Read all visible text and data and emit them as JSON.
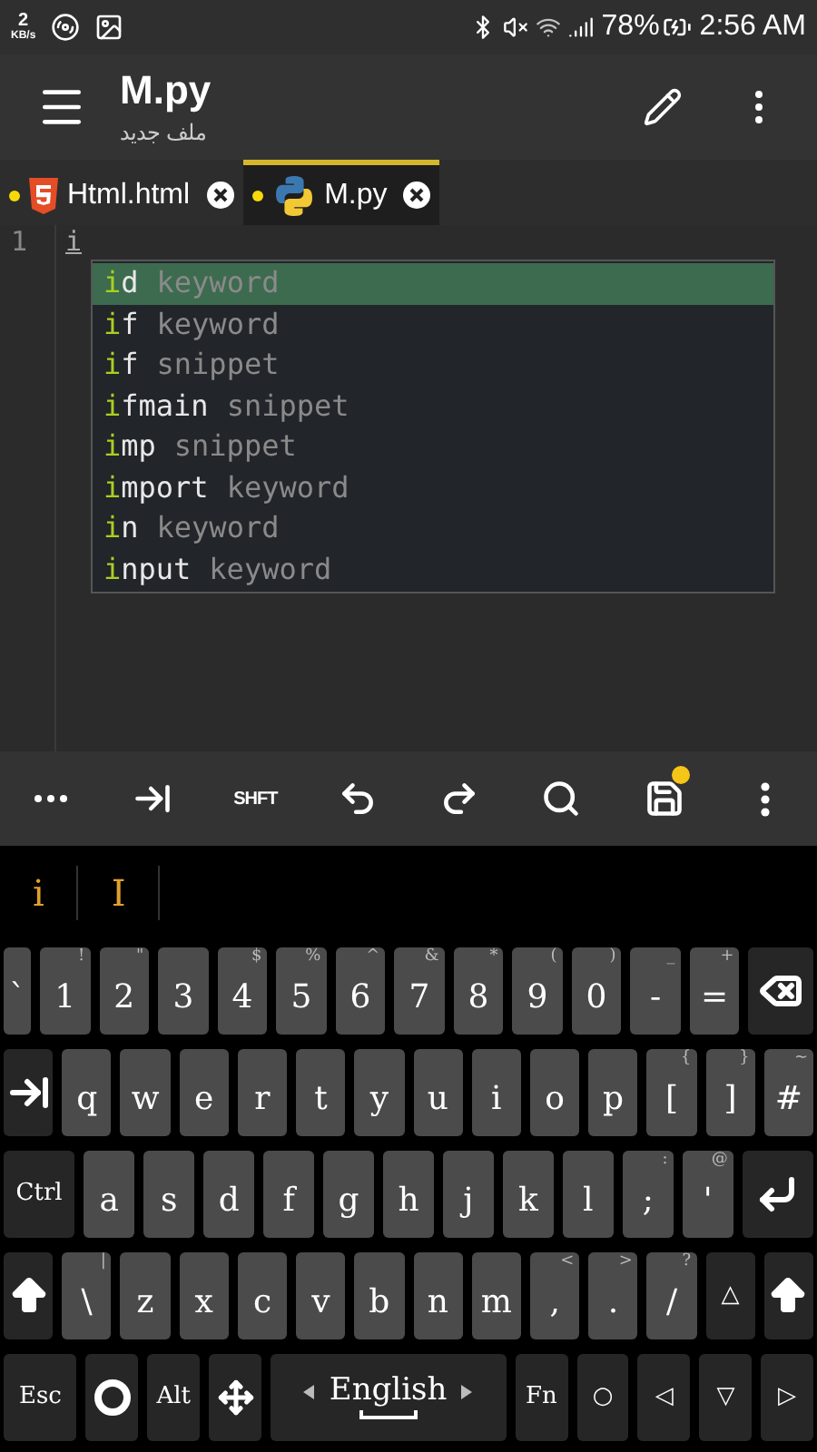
{
  "status_bar": {
    "speed_value": "2",
    "speed_unit": "KB/s",
    "battery": "78%",
    "time": "2:56 AM"
  },
  "app_bar": {
    "title": "M.py",
    "subtitle": "ملف جديد"
  },
  "tabs": [
    {
      "label": "Html.html",
      "kind": "html",
      "modified": true,
      "selected": false
    },
    {
      "label": "M.py",
      "kind": "python",
      "modified": true,
      "selected": true
    }
  ],
  "editor": {
    "line_numbers": [
      "1"
    ],
    "lines": [
      "i"
    ]
  },
  "autocomplete": [
    {
      "match": "i",
      "rest": "d",
      "type": "keyword",
      "selected": true
    },
    {
      "match": "i",
      "rest": "f",
      "type": "keyword",
      "selected": false
    },
    {
      "match": "i",
      "rest": "f",
      "type": "snippet",
      "selected": false
    },
    {
      "match": "i",
      "rest": "fmain",
      "type": "snippet",
      "selected": false
    },
    {
      "match": "i",
      "rest": "mp",
      "type": "snippet",
      "selected": false
    },
    {
      "match": "i",
      "rest": "mport",
      "type": "keyword",
      "selected": false
    },
    {
      "match": "i",
      "rest": "n",
      "type": "keyword",
      "selected": false
    },
    {
      "match": "i",
      "rest": "nput",
      "type": "keyword",
      "selected": false
    }
  ],
  "toolbar": [
    {
      "kind": "more"
    },
    {
      "kind": "tab"
    },
    {
      "kind": "text",
      "label": "SHFT"
    },
    {
      "kind": "undo"
    },
    {
      "kind": "redo"
    },
    {
      "kind": "search"
    },
    {
      "kind": "save",
      "badge": true
    },
    {
      "kind": "menu"
    }
  ],
  "suggestions": [
    "i",
    "I"
  ],
  "keyboard": [
    [
      {
        "kind": "narrow",
        "label": "`"
      },
      {
        "kind": "char",
        "label": "1",
        "hint": "!"
      },
      {
        "kind": "char",
        "label": "2",
        "hint": "\""
      },
      {
        "kind": "char",
        "label": "3"
      },
      {
        "kind": "char",
        "label": "4",
        "hint": "$"
      },
      {
        "kind": "char",
        "label": "5",
        "hint": "%"
      },
      {
        "kind": "char",
        "label": "6",
        "hint": "^"
      },
      {
        "kind": "char",
        "label": "7",
        "hint": "&"
      },
      {
        "kind": "char",
        "label": "8",
        "hint": "*"
      },
      {
        "kind": "char",
        "label": "9",
        "hint": "("
      },
      {
        "kind": "char",
        "label": "0",
        "hint": ")"
      },
      {
        "kind": "char",
        "label": "-",
        "hint": "_"
      },
      {
        "kind": "char",
        "label": "=",
        "hint": "+"
      },
      {
        "kind": "backspace"
      }
    ],
    [
      {
        "kind": "tab"
      },
      {
        "kind": "char",
        "label": "q"
      },
      {
        "kind": "char",
        "label": "w"
      },
      {
        "kind": "char",
        "label": "e"
      },
      {
        "kind": "char",
        "label": "r"
      },
      {
        "kind": "char",
        "label": "t"
      },
      {
        "kind": "char",
        "label": "y"
      },
      {
        "kind": "char",
        "label": "u"
      },
      {
        "kind": "char",
        "label": "i"
      },
      {
        "kind": "char",
        "label": "o"
      },
      {
        "kind": "char",
        "label": "p"
      },
      {
        "kind": "char",
        "label": "[",
        "hint": "{"
      },
      {
        "kind": "char",
        "label": "]",
        "hint": "}"
      },
      {
        "kind": "char",
        "label": "#",
        "hint": "~"
      }
    ],
    [
      {
        "kind": "mod-wide",
        "label": "Ctrl"
      },
      {
        "kind": "char",
        "label": "a"
      },
      {
        "kind": "char",
        "label": "s"
      },
      {
        "kind": "char",
        "label": "d"
      },
      {
        "kind": "char",
        "label": "f"
      },
      {
        "kind": "char",
        "label": "g"
      },
      {
        "kind": "char",
        "label": "h"
      },
      {
        "kind": "char",
        "label": "j"
      },
      {
        "kind": "char",
        "label": "k"
      },
      {
        "kind": "char",
        "label": "l"
      },
      {
        "kind": "char",
        "label": ";",
        "hint": ":"
      },
      {
        "kind": "char",
        "label": "'",
        "hint": "@"
      },
      {
        "kind": "enter"
      }
    ],
    [
      {
        "kind": "shift"
      },
      {
        "kind": "char",
        "label": "\\",
        "hint": "|"
      },
      {
        "kind": "char",
        "label": "z"
      },
      {
        "kind": "char",
        "label": "x"
      },
      {
        "kind": "char",
        "label": "c"
      },
      {
        "kind": "char",
        "label": "v"
      },
      {
        "kind": "char",
        "label": "b"
      },
      {
        "kind": "char",
        "label": "n"
      },
      {
        "kind": "char",
        "label": "m"
      },
      {
        "kind": "char",
        "label": ",",
        "hint": "<"
      },
      {
        "kind": "char",
        "label": ".",
        "hint": ">"
      },
      {
        "kind": "char",
        "label": "/",
        "hint": "?"
      },
      {
        "kind": "mod",
        "label": "△"
      },
      {
        "kind": "shift"
      }
    ],
    [
      {
        "kind": "mod-wide",
        "label": "Esc"
      },
      {
        "kind": "settings"
      },
      {
        "kind": "mod",
        "label": "Alt"
      },
      {
        "kind": "dpad"
      },
      {
        "kind": "space",
        "label": "English"
      },
      {
        "kind": "mod",
        "label": "Fn"
      },
      {
        "kind": "mod",
        "label": "○"
      },
      {
        "kind": "mod",
        "label": "◁"
      },
      {
        "kind": "mod",
        "label": "▽"
      },
      {
        "kind": "mod",
        "label": "▷"
      }
    ]
  ]
}
